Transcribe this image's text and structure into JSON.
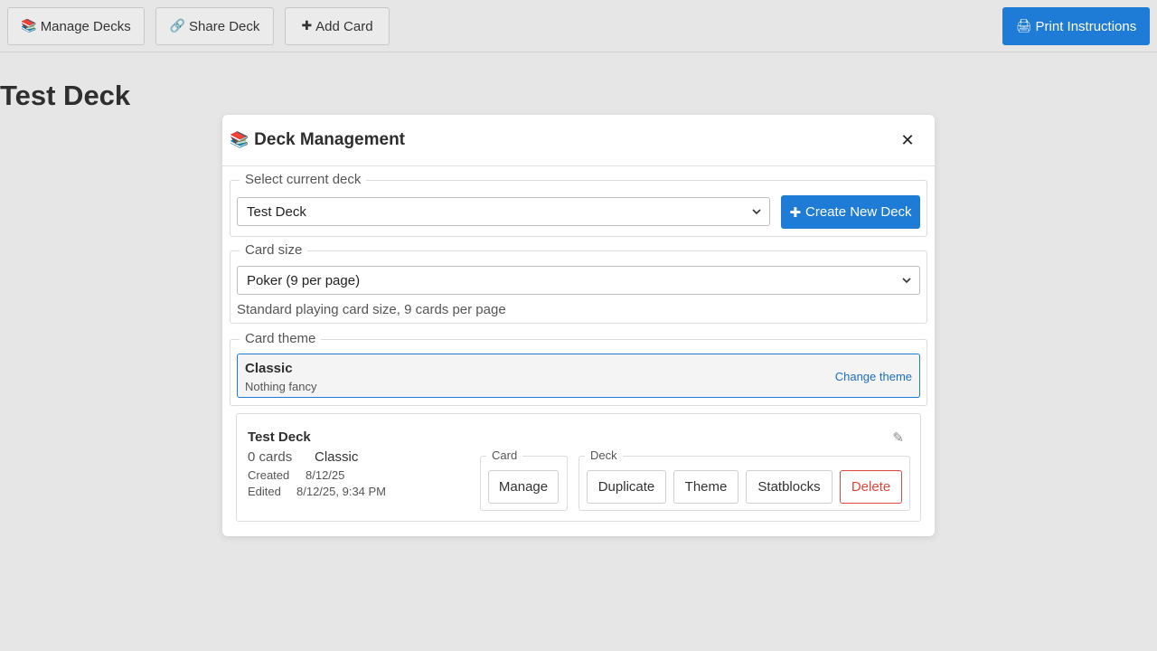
{
  "toolbar": {
    "manage_decks": {
      "icon": "books-icon",
      "glyph": "📚",
      "label": "Manage Decks"
    },
    "share_deck": {
      "icon": "link-icon",
      "glyph": "🔗",
      "label": "Share Deck"
    },
    "add_card": {
      "icon": "plus-icon",
      "glyph": "✚",
      "label": "Add Card"
    },
    "print_instructions": {
      "icon": "printer-icon",
      "glyph": "🖨",
      "label": "Print Instructions"
    }
  },
  "page": {
    "title": "Test Deck"
  },
  "modal": {
    "title": "Deck Management",
    "title_glyph": "📚",
    "close_glyph": "✕",
    "select_deck": {
      "legend": "Select current deck",
      "selected": "Test Deck",
      "create_glyph": "✚",
      "create_label": "Create New Deck"
    },
    "card_size": {
      "legend": "Card size",
      "selected": "Poker (9 per page)",
      "hint": "Standard playing card size, 9 cards per page"
    },
    "card_theme": {
      "legend": "Card theme",
      "name": "Classic",
      "description": "Nothing fancy",
      "change_label": "Change theme"
    },
    "deck": {
      "name": "Test Deck",
      "count": "0 cards",
      "theme": "Classic",
      "created_label": "Created",
      "created_value": "8/12/25",
      "edited_label": "Edited",
      "edited_value": "8/12/25, 9:34 PM",
      "edit_glyph": "✎",
      "card_group": {
        "legend": "Card",
        "manage": "Manage"
      },
      "deck_group": {
        "legend": "Deck",
        "duplicate": "Duplicate",
        "theme": "Theme",
        "statblocks": "Statblocks",
        "delete": "Delete"
      }
    }
  },
  "colors": {
    "accent": "#1e7bd6",
    "danger": "#e0463c",
    "background": "#e6e6e6"
  }
}
